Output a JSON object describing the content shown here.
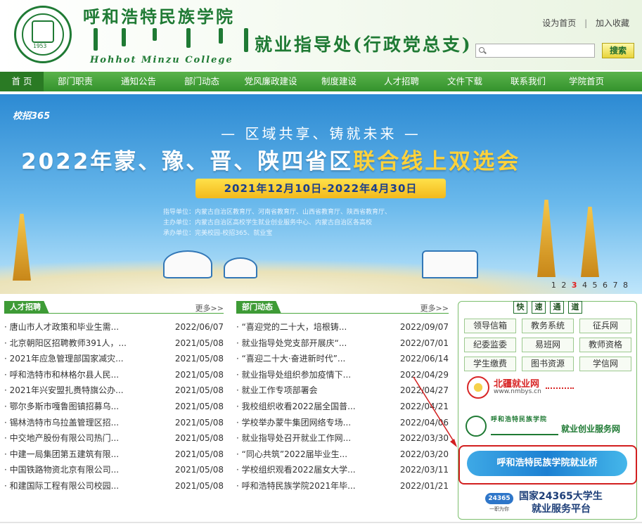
{
  "header": {
    "college_cn": "呼和浩特民族学院",
    "college_en": "Hohhot Minzu College",
    "seal_year": "1953",
    "site_title": "就业指导处(行政党总支)",
    "set_home": "设为首页",
    "separator": "|",
    "add_favorite": "加入收藏",
    "search_placeholder": "",
    "search_button": "搜索"
  },
  "nav": {
    "items": [
      "首 页",
      "部门职责",
      "通知公告",
      "部门动态",
      "党风廉政建设",
      "制度建设",
      "人才招聘",
      "文件下载",
      "联系我们",
      "学院首页"
    ]
  },
  "banner": {
    "logo": "校招365",
    "subtitle": "— 区域共享、铸就未来 —",
    "title_main": "2022年蒙、豫、晋、陕四省区",
    "title_highlight": "联合线上双选会",
    "date_range": "2021年12月10日-2022年4月30日",
    "guide": "指导单位：内蒙古自治区教育厅、河南省教育厅、山西省教育厅、陕西省教育厅、",
    "host": "主办单位：内蒙古自治区高校学生就业创业服务中心、内蒙古自治区各高校",
    "organizer": "承办单位：完美校园-校招365、就业宝",
    "slides": [
      "1",
      "2",
      "3",
      "4",
      "5",
      "6",
      "7",
      "8"
    ],
    "current_slide": "3"
  },
  "recruit": {
    "tag": "人才招聘",
    "more": "更多>>",
    "rows": [
      {
        "title": "· 唐山市人才政策和毕业生需...",
        "date": "2022/06/07"
      },
      {
        "title": "· 北京朝阳区招聘教师391人，...",
        "date": "2021/05/08"
      },
      {
        "title": "· 2021年应急管理部国家减灾...",
        "date": "2021/05/08"
      },
      {
        "title": "· 呼和浩特市和林格尔县人民...",
        "date": "2021/05/08"
      },
      {
        "title": "· 2021年兴安盟扎赉特旗公办...",
        "date": "2021/05/08"
      },
      {
        "title": "· 鄂尔多斯市嘎鲁图镇招募乌...",
        "date": "2021/05/08"
      },
      {
        "title": "· 锡林浩特市乌拉盖管理区招...",
        "date": "2021/05/08"
      },
      {
        "title": "· 中交地产股份有限公司热门...",
        "date": "2021/05/08"
      },
      {
        "title": "· 中建一局集团第五建筑有限...",
        "date": "2021/05/08"
      },
      {
        "title": "· 中国铁路物资北京有限公司...",
        "date": "2021/05/08"
      },
      {
        "title": "· 和建国际工程有限公司校园...",
        "date": "2021/05/08"
      }
    ]
  },
  "dept_news": {
    "tag": "部门动态",
    "more": "更多>>",
    "rows": [
      {
        "title": "· “喜迎党的二十大，培根铸...",
        "date": "2022/09/07"
      },
      {
        "title": "· 就业指导处党支部开展庆“...",
        "date": "2022/07/01"
      },
      {
        "title": "· “喜迎二十大·奋进新时代”...",
        "date": "2022/06/14"
      },
      {
        "title": "· 就业指导处组织参加疫情下...",
        "date": "2022/04/29"
      },
      {
        "title": "· 就业工作专项部署会",
        "date": "2022/04/27"
      },
      {
        "title": "· 我校组织收看2022届全国普...",
        "date": "2022/04/21"
      },
      {
        "title": "· 学校举办蒙牛集团网络专场...",
        "date": "2022/04/06"
      },
      {
        "title": "· 就业指导处召开就业工作网...",
        "date": "2022/03/30"
      },
      {
        "title": "· “同心共筑”2022届毕业生...",
        "date": "2022/03/20"
      },
      {
        "title": "· 学校组织观看2022届女大学...",
        "date": "2022/03/11"
      },
      {
        "title": "· 呼和浩特民族学院2021年毕...",
        "date": "2022/01/21"
      }
    ]
  },
  "quick": {
    "title_chars": [
      "快",
      "速",
      "通",
      "道"
    ],
    "links": [
      "领导信箱",
      "教务系统",
      "征兵网",
      "纪委监委",
      "易班网",
      "教师资格",
      "学生缴费",
      "图书资源",
      "学信网"
    ],
    "nmbys_name": "北疆就业网",
    "nmbys_url": "www.nmbys.cn",
    "college_mini": "呼和浩特民族学院",
    "cy_label": "就业创业服务网",
    "bridge": "呼和浩特民族学院就业桥",
    "n24_badge": "24365",
    "n24_sub": "一职为你",
    "n24_line1": "国家24365大学生",
    "n24_line2": "就业服务平台"
  },
  "colors": {
    "brand_green": "#1f7a34",
    "nav_green": "#3e9b36",
    "highlight_red": "#d21f1f",
    "banner_yellow": "#ffd23a"
  }
}
